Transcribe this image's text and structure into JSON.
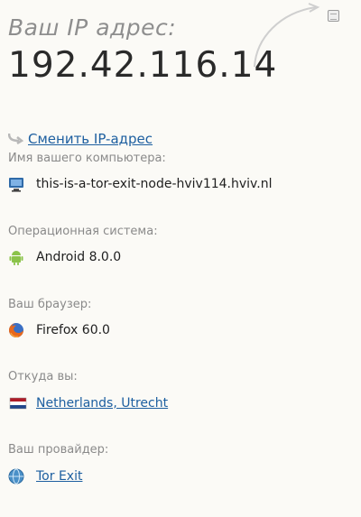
{
  "header": {
    "ip_label": "Ваш IP адрес:",
    "ip_address": "192.42.116.14"
  },
  "change_ip": {
    "link_text": "Сменить IP-адрес"
  },
  "computer": {
    "label": "Имя вашего компьютера:",
    "value": "this-is-a-tor-exit-node-hviv114.hviv.nl",
    "icon": "computer-icon"
  },
  "os": {
    "label": "Операционная система:",
    "value": "Android 8.0.0",
    "icon": "android-icon"
  },
  "browser": {
    "label": "Ваш браузер:",
    "value": "Firefox 60.0",
    "icon": "firefox-icon"
  },
  "location": {
    "label": "Откуда вы:",
    "value": "Netherlands, Utrecht",
    "icon": "netherlands-flag-icon"
  },
  "provider": {
    "label": "Ваш провайдер:",
    "value": "Tor Exit",
    "icon": "globe-icon"
  },
  "colors": {
    "link": "#1d5fa0",
    "label": "#8a8a8a",
    "background": "#fbfaf6"
  }
}
